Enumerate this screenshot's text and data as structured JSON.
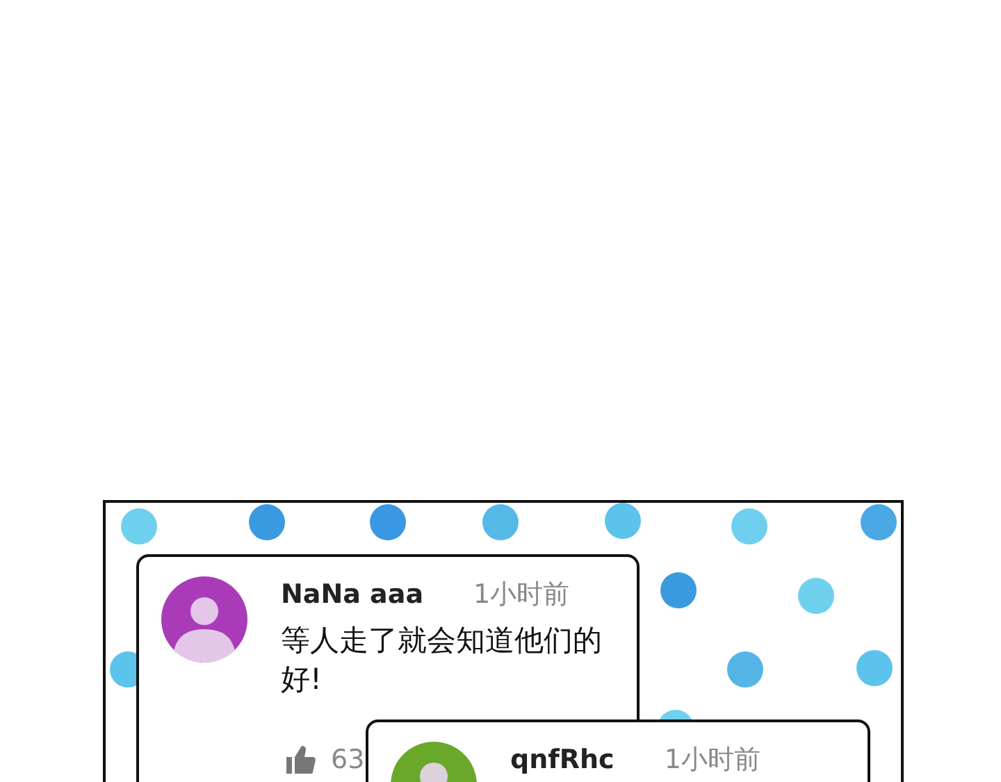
{
  "comments": [
    {
      "name": "NaNa aaa",
      "time": "1小时前",
      "text": "等人走了就会知道他们的好!",
      "likes": "63",
      "color": "#a93bb8"
    },
    {
      "name": "qnfRhc",
      "time": "1小时前",
      "color": "#6aa82a"
    }
  ]
}
